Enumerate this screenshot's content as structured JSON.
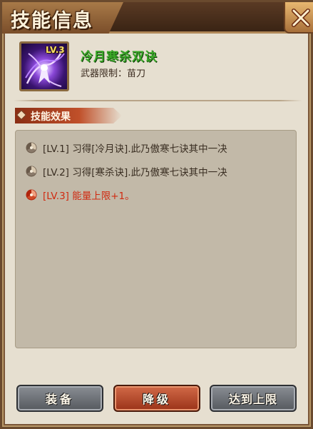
{
  "header": {
    "title": "技能信息"
  },
  "skill": {
    "level_badge": "LV.3",
    "name": "冷月寒杀双诀",
    "weapon_limit": "武器限制：苗刀"
  },
  "effects_section": {
    "title": "技能效果",
    "items": [
      {
        "text": "[LV.1]  习得[冷月诀].此乃傲寒七诀其中一决",
        "active": false
      },
      {
        "text": "[LV.2]  习得[寒杀诀].此乃傲寒七诀其中一决",
        "active": false
      },
      {
        "text": "[LV.3]  能量上限+1。",
        "active": true
      }
    ]
  },
  "buttons": {
    "equip": "装备",
    "downgrade": "降级",
    "max_reached": "达到上限"
  },
  "colors": {
    "skill_name": "#3aa828",
    "active_effect": "#d02a10",
    "inactive_effect": "#3a2e22"
  }
}
